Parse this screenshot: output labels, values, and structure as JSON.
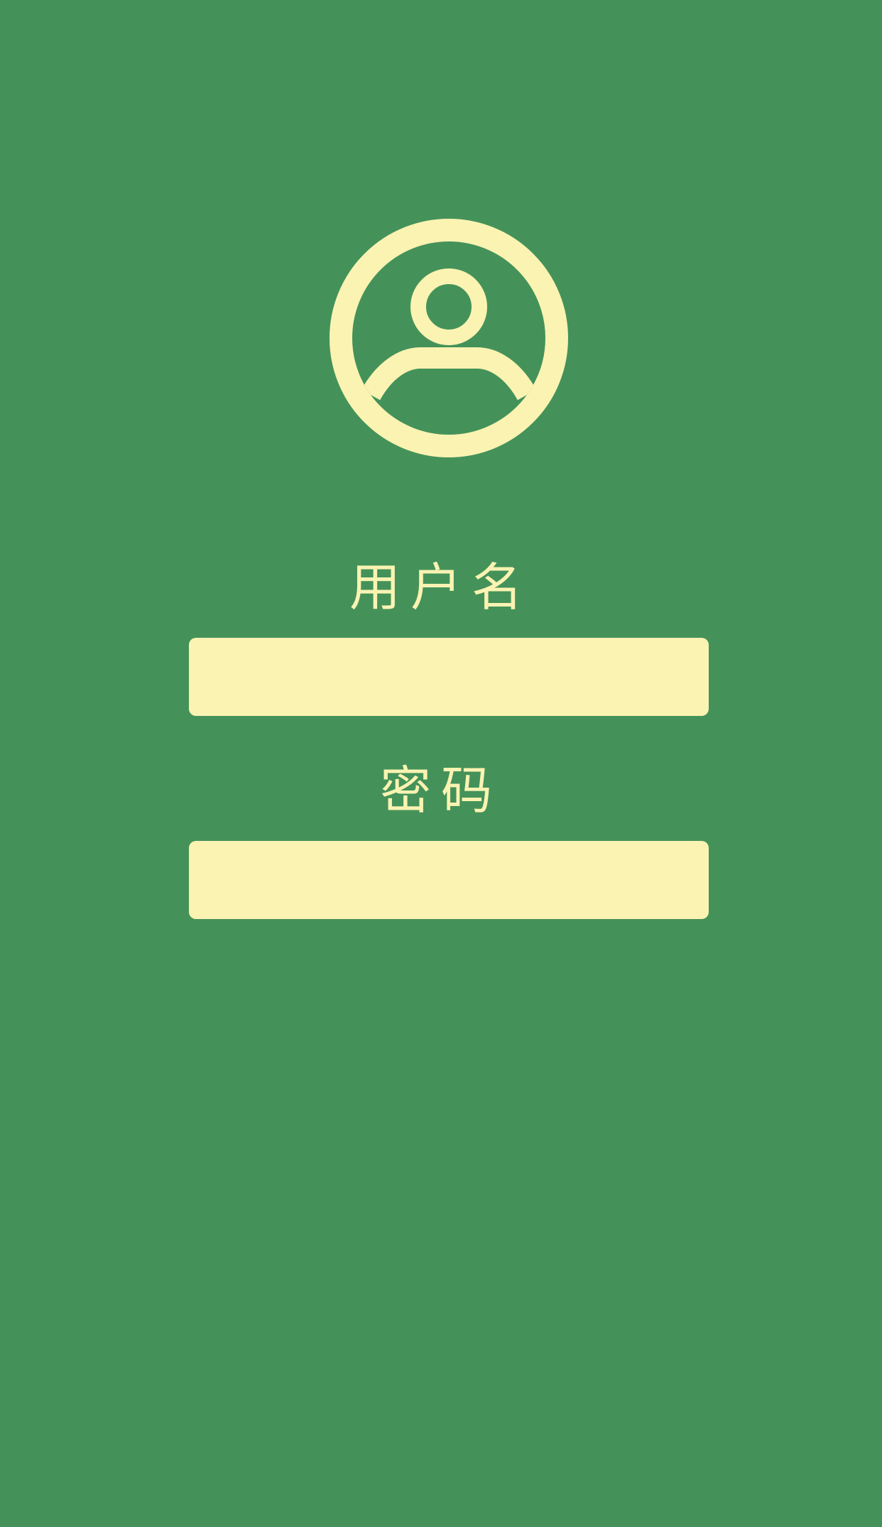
{
  "login": {
    "avatar_icon": "user-circle-icon",
    "username_label": "用户名",
    "username_value": "",
    "username_placeholder": "",
    "password_label": "密码",
    "password_value": "",
    "password_placeholder": ""
  },
  "colors": {
    "background": "#44925a",
    "accent": "#fbf3b2"
  }
}
